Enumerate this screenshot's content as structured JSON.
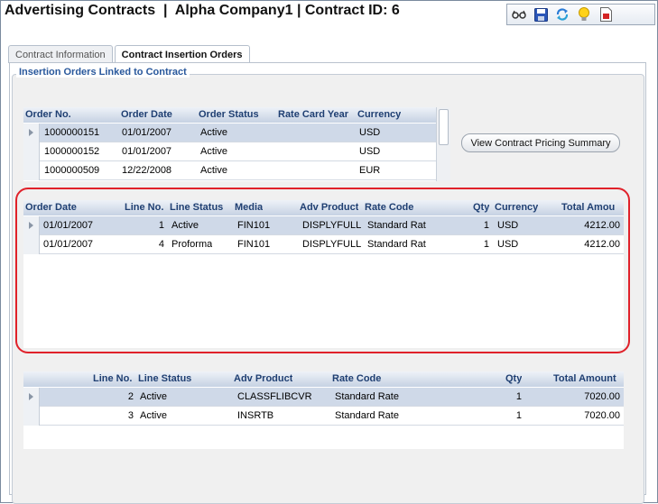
{
  "window": {
    "title": "Advertising Contracts  |  Alpha Company1 | Contract ID: 6"
  },
  "toolbar": {
    "icons": [
      "glasses-icon",
      "save-icon",
      "refresh-icon",
      "lightbulb-icon",
      "report-icon"
    ]
  },
  "tabs": [
    {
      "label": "Contract Information",
      "active": false
    },
    {
      "label": "Contract Insertion Orders",
      "active": true
    }
  ],
  "group": {
    "legend": "Insertion Orders Linked to Contract"
  },
  "orders_grid": {
    "columns": [
      "Order No.",
      "Order Date",
      "Order Status",
      "Rate Card Year",
      "Currency"
    ],
    "rows": [
      {
        "order_no": "1000000151",
        "order_date": "01/01/2007",
        "status": "Active",
        "rate_card_year": "",
        "currency": "USD"
      },
      {
        "order_no": "1000000152",
        "order_date": "01/01/2007",
        "status": "Active",
        "rate_card_year": "",
        "currency": "USD"
      },
      {
        "order_no": "1000000509",
        "order_date": "12/22/2008",
        "status": "Active",
        "rate_card_year": "",
        "currency": "EUR"
      }
    ]
  },
  "pricing_button": {
    "label": "View Contract Pricing Summary"
  },
  "lines_grid": {
    "columns": [
      "Order Date",
      "Line No.",
      "Line Status",
      "Media",
      "Adv Product",
      "Rate Code",
      "Qty",
      "Currency",
      "Total Amou"
    ],
    "rows": [
      {
        "order_date": "01/01/2007",
        "line_no": "1",
        "line_status": "Active",
        "media": "FIN101",
        "adv_product": "DISPLYFULL",
        "rate_code": "Standard Rat",
        "qty": "1",
        "currency": "USD",
        "total": "4212.00"
      },
      {
        "order_date": "01/01/2007",
        "line_no": "4",
        "line_status": "Proforma",
        "media": "FIN101",
        "adv_product": "DISPLYFULL",
        "rate_code": "Standard Rat",
        "qty": "1",
        "currency": "USD",
        "total": "4212.00"
      }
    ]
  },
  "products_grid": {
    "columns": [
      "Line No.",
      "Line Status",
      "Adv Product",
      "Rate Code",
      "Qty",
      "Total Amount"
    ],
    "rows": [
      {
        "line_no": "2",
        "line_status": "Active",
        "adv_product": "CLASSFLIBCVR",
        "rate_code": "Standard Rate",
        "qty": "1",
        "total": "7020.00"
      },
      {
        "line_no": "3",
        "line_status": "Active",
        "adv_product": "INSRTB",
        "rate_code": "Standard Rate",
        "qty": "1",
        "total": "7020.00"
      }
    ]
  },
  "highlight_color": "#e0212a"
}
